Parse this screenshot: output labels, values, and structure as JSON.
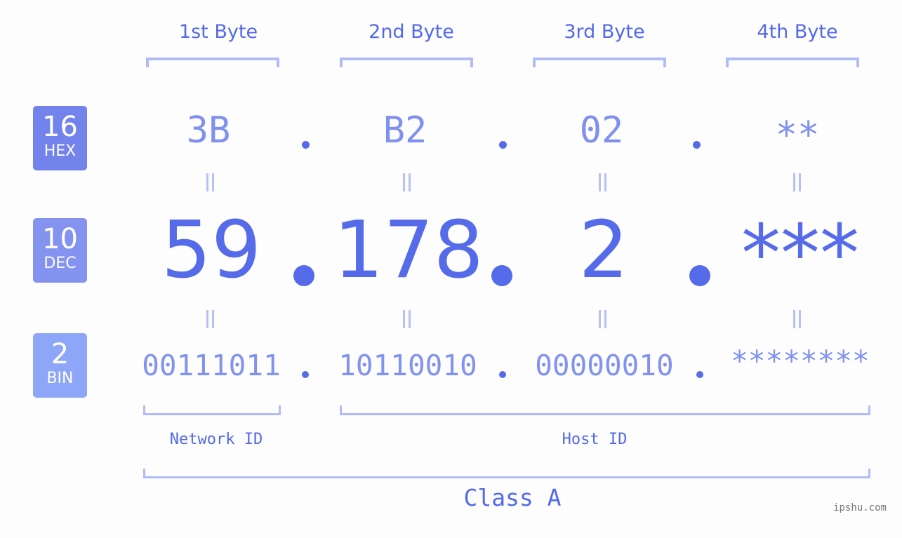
{
  "byte_headers": [
    "1st Byte",
    "2nd Byte",
    "3rd Byte",
    "4th Byte"
  ],
  "rows": {
    "hex": {
      "base": "16",
      "label": "HEX",
      "values": [
        "3B",
        "B2",
        "02",
        "**"
      ],
      "badge_color": "#7383ec"
    },
    "dec": {
      "base": "10",
      "label": "DEC",
      "values": [
        "59",
        "178",
        "2",
        "***"
      ],
      "badge_color": "#8593f0"
    },
    "bin": {
      "base": "2",
      "label": "BIN",
      "values": [
        "00111011",
        "10110010",
        "00000010",
        "********"
      ],
      "badge_color": "#8ea6f7"
    }
  },
  "segments": {
    "network_id": "Network ID",
    "host_id": "Host ID"
  },
  "ip_class": "Class A",
  "watermark": "ipshu.com",
  "colors": {
    "accent": "#566bea",
    "bracket": "#b1bcf6",
    "hex_text": "#8090ee",
    "bin_text": "#8293ef"
  }
}
